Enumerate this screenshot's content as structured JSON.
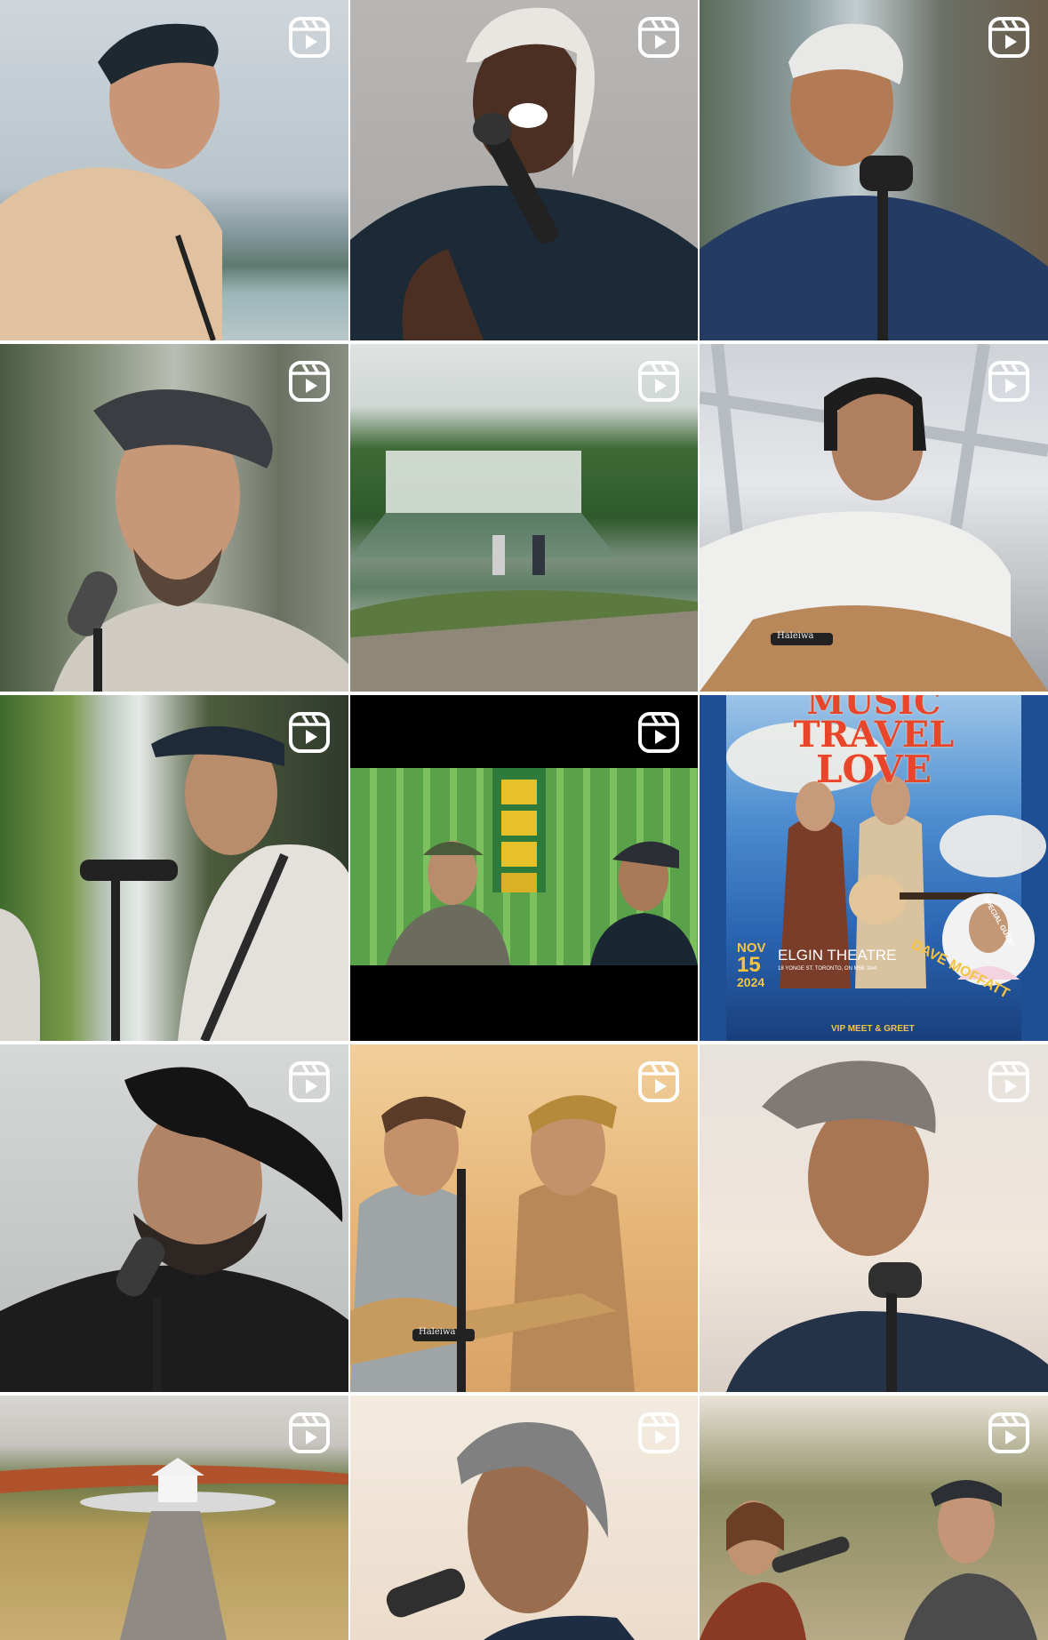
{
  "grid": {
    "tiles": [
      {
        "label": "Reel: singer with backwards cap by the sea",
        "icon": "reels-icon"
      },
      {
        "label": "Reel: singer in white head wrap at microphone",
        "icon": "reels-icon"
      },
      {
        "label": "Reel: singer in white cap near waterfall",
        "icon": "reels-icon"
      },
      {
        "label": "Reel: singer in grey cap at microphone",
        "icon": "reels-icon"
      },
      {
        "label": "Reel: two guitarists in front of waterfall",
        "icon": "reels-icon"
      },
      {
        "label": "Reel: guitarist with headphones on bridge",
        "icon": "reels-icon"
      },
      {
        "label": "Reel: singer at microphone by waterfall",
        "icon": "reels-icon"
      },
      {
        "label": "Reel: two musicians on city street",
        "icon": "reels-icon"
      },
      {
        "label": "Reel: Music Travel Love tour poster",
        "icon": "reels-icon"
      },
      {
        "label": "Reel: singer in cowboy hat",
        "icon": "reels-icon"
      },
      {
        "label": "Reel: two guitarists singing at sunset",
        "icon": "reels-icon"
      },
      {
        "label": "Reel: singer in backwards cap at sunset",
        "icon": "reels-icon"
      },
      {
        "label": "Reel: gazebo at end of long path",
        "icon": "reels-icon"
      },
      {
        "label": "Reel: singer with grey cap close-up",
        "icon": "reels-icon"
      },
      {
        "label": "Reel: duet singers outdoors",
        "icon": "reels-icon"
      }
    ]
  },
  "poster": {
    "title_line1": "MUSIC",
    "title_line2": "TRAVEL",
    "title_line3": "LOVE",
    "month": "NOV",
    "day": "15",
    "year": "2024",
    "venue": "ELGIN THEATRE",
    "address": "18 YONGE ST. TORONTO, ON M5B 1M4",
    "special": "SPECIAL GUEST",
    "guest": "DAVE MOFFATT",
    "footer": "VIP MEET & GREET"
  },
  "guitar_brand": "Haleiwa",
  "colors": {
    "poster_blue": "#2a63b0",
    "poster_title": "#e8452b"
  }
}
